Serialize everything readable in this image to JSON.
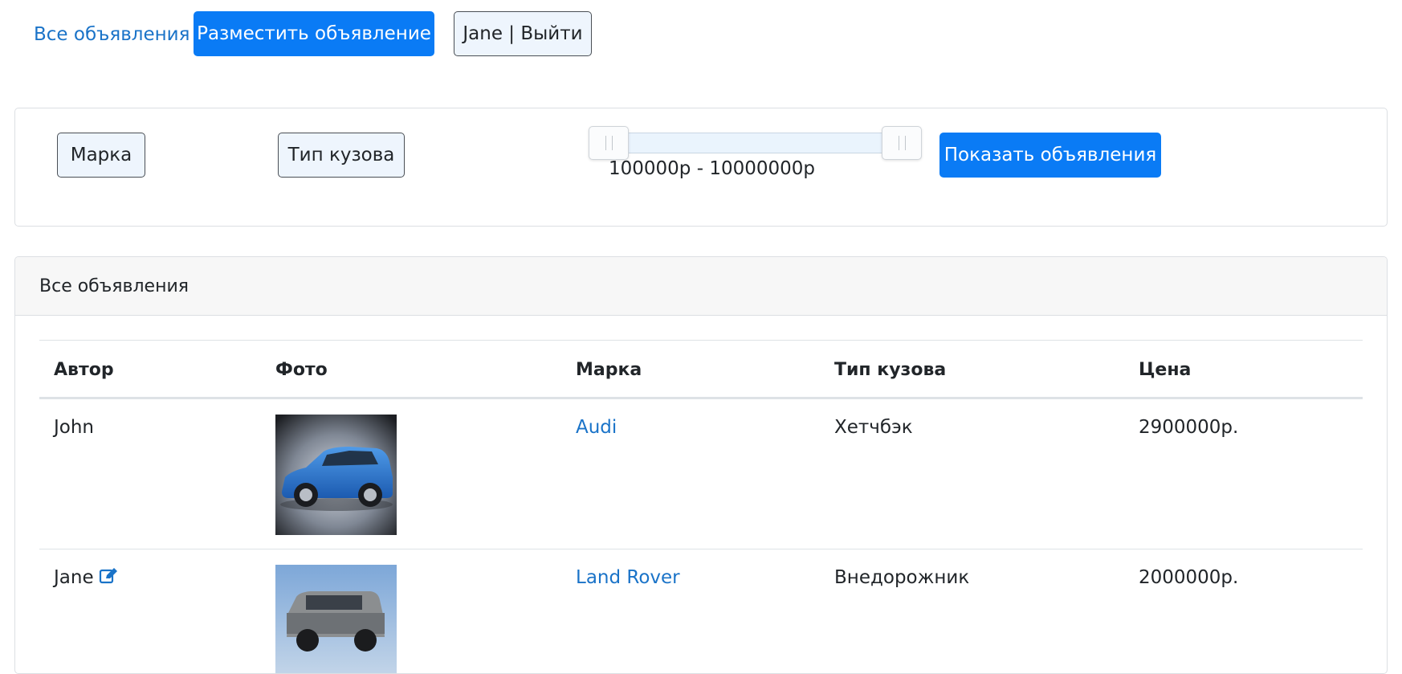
{
  "nav": {
    "all_ads_label": "Все объявления",
    "post_ad_label": "Разместить объявление",
    "user_logout_label": "Jane | Выйти"
  },
  "filters": {
    "brand_label": "Марка",
    "body_type_label": "Тип кузова",
    "price_range_text": "100000р - 10000000р",
    "price_min": 100000,
    "price_max": 10000000,
    "show_button_label": "Показать объявления"
  },
  "listings": {
    "header_title": "Все объявления",
    "columns": [
      "Автор",
      "Фото",
      "Марка",
      "Тип кузова",
      "Цена"
    ],
    "rows": [
      {
        "author": "John",
        "brand": "Audi",
        "body_type": "Хетчбэк",
        "price": "2900000р.",
        "editable": false
      },
      {
        "author": "Jane",
        "brand": "Land Rover",
        "body_type": "Внедорожник",
        "price": "2000000р.",
        "editable": true
      }
    ]
  },
  "colors": {
    "primary": "#0a7bf5",
    "link": "#1a73c8",
    "outline_bg": "#eef5fd"
  }
}
